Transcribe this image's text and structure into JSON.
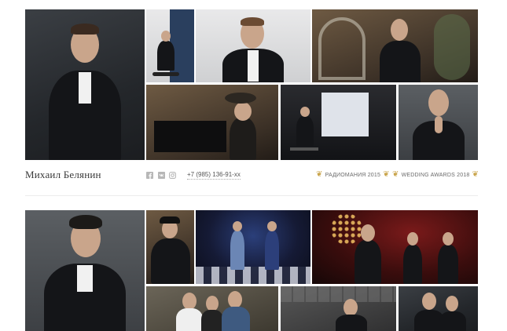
{
  "profiles": [
    {
      "name": "Михаил Белянин",
      "phone": "+7 (985) 136-91-xx",
      "social_icons": [
        "facebook-icon",
        "vk-icon",
        "instagram-icon"
      ],
      "awards": [
        "РАДИОМАНИЯ 2015",
        "WEDDING AWARDS 2018"
      ]
    }
  ],
  "colors": {
    "background": "#ffffff",
    "text": "#3a3a3a",
    "muted": "#6a6a6a",
    "laurel": "#c9a44a",
    "divider": "#ececec"
  }
}
